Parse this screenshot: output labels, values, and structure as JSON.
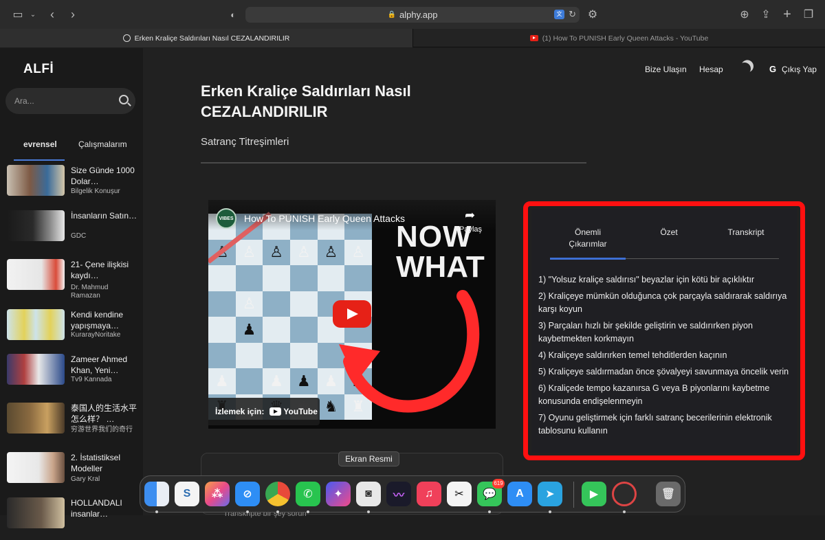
{
  "browser": {
    "url": "alphy.app",
    "tabs": [
      {
        "title": "Erken Kraliçe Saldırıları Nasıl CEZALANDIRILIR"
      },
      {
        "title": "(1) How To PUNISH Early Queen Attacks - YouTube"
      }
    ]
  },
  "sidebar": {
    "logo": "ALFİ",
    "search_placeholder": "Ara...",
    "tabs": [
      "evrensel",
      "Çalışmalarım"
    ],
    "items": [
      {
        "title": "Size Günde 1000 Dolar…",
        "source": "Bilgelik Konuşur"
      },
      {
        "title": "İnsanların Satın…",
        "source": "GDC"
      },
      {
        "title": "21- Çene ilişkisi kaydı…",
        "source": "Dr. Mahmud Ramazan"
      },
      {
        "title": "Kendi kendine yapışmaya…",
        "source": "KurarayNoritake"
      },
      {
        "title": "Zameer Ahmed Khan, Yeni…",
        "source": "Tv9 Kannada"
      },
      {
        "title": "泰国人的生活水平怎么样？ …",
        "source": "穷游世界我们的奇行"
      },
      {
        "title": "2. İstatistiksel Modeller",
        "source": "Gary Kral"
      },
      {
        "title": "HOLLANDALI insanlar…",
        "source": ""
      }
    ]
  },
  "header": {
    "contact": "Bize Ulaşın",
    "account": "Hesap",
    "logout": "Çıkış Yap"
  },
  "page": {
    "title": "Erken Kraliçe Saldırıları Nasıl CEZALANDIRILIR",
    "subtitle": "Satranç Titreşimleri"
  },
  "video": {
    "channel_logo": "VIBES",
    "title": "How To PUNISH Early Queen Attacks",
    "share": "Paylaş",
    "overlay_line1": "NOW",
    "overlay_line2": "WHAT",
    "watch_on": "İzlemek için:",
    "youtube": "YouTube"
  },
  "chat": {
    "placeholder": "Transkripte bir şey sorun"
  },
  "panel": {
    "tabs": [
      "Önemli Çıkarımlar",
      "Özet",
      "Transkript"
    ],
    "points": [
      "1) \"Yolsuz kraliçe saldırısı\" beyazlar için kötü bir açıklıktır",
      "2) Kraliçeye mümkün olduğunca çok parçayla saldırarak saldırıya karşı koyun",
      "3) Parçaları hızlı bir şekilde geliştirin ve saldırırken piyon kaybetmekten korkmayın",
      "4) Kraliçeye saldırırken temel tehditlerden kaçının",
      "5) Kraliçeye saldırmadan önce şövalyeyi savunmaya öncelik verin",
      "6) Kraliçede tempo kazanırsa G veya B piyonlarını kaybetme konusunda endişelenmeyin",
      "7) Oyunu geliştirmek için farklı satranç becerilerinin elektronik tablosunu kullanın"
    ]
  },
  "tooltip": "Ekran Resmi",
  "dock": {
    "messages_badge": "619"
  }
}
